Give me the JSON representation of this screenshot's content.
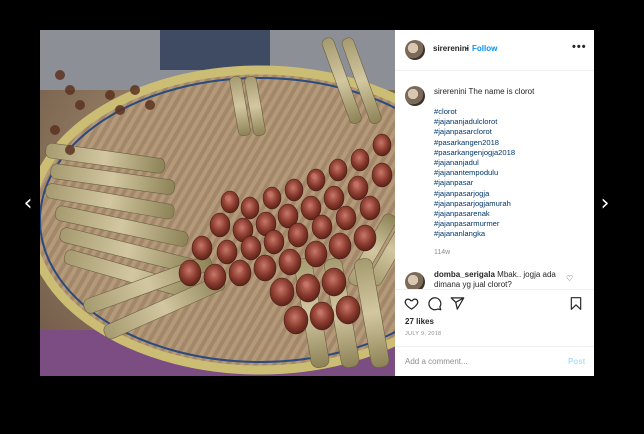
{
  "navigation": {
    "prev_icon": "chevron-left-icon",
    "next_icon": "chevron-right-icon"
  },
  "post": {
    "image_alt": "Photo of clorot snacks in a woven basket",
    "header": {
      "username": "sirerenini",
      "separator": "•",
      "follow_label": "Follow",
      "more_label": "•••"
    },
    "caption": {
      "username": "sirerenini",
      "text": "The name is clorot",
      "hashtags": [
        "#clorot",
        "#jajananjadulclorot",
        "#jajanpasarclorot",
        "#pasarkangen2018",
        "#pasarkangenjogja2018",
        "#jajananjadul",
        "#jajanantempodulu",
        "#jajanpasar",
        "#jajanpasarjogja",
        "#jajanpasarjogjamurah",
        "#jajanpasarenak",
        "#jajanpasarmurmer",
        "#jajananlangka"
      ],
      "age": "114w"
    },
    "comments": [
      {
        "username": "domba_serigala",
        "text": "Mbak.. jogja ada dimana yg jual clorot?"
      }
    ],
    "likes": "27 likes",
    "date": "JULY 9, 2018",
    "add_comment_placeholder": "Add a comment...",
    "post_button": "Post",
    "icons": {
      "like": "heart-icon",
      "comment": "comment-icon",
      "share": "share-icon",
      "save": "bookmark-icon"
    }
  }
}
